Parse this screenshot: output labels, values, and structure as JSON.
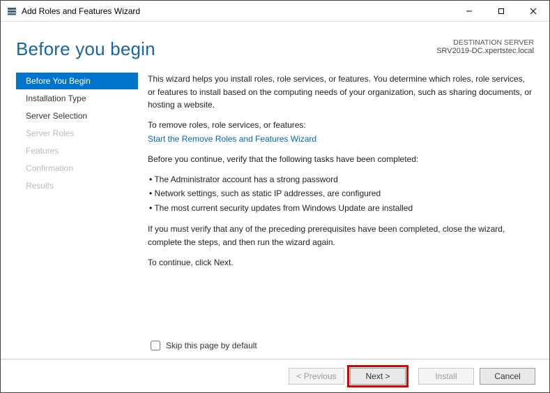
{
  "window": {
    "title": "Add Roles and Features Wizard",
    "icon": "server-manager-icon"
  },
  "header": {
    "title": "Before you begin",
    "destination_label": "DESTINATION SERVER",
    "destination_server": "SRV2019-DC.xpertstec.local"
  },
  "sidebar": {
    "items": [
      {
        "label": "Before You Begin",
        "state": "active"
      },
      {
        "label": "Installation Type",
        "state": "enabled"
      },
      {
        "label": "Server Selection",
        "state": "enabled"
      },
      {
        "label": "Server Roles",
        "state": "disabled"
      },
      {
        "label": "Features",
        "state": "disabled"
      },
      {
        "label": "Confirmation",
        "state": "disabled"
      },
      {
        "label": "Results",
        "state": "disabled"
      }
    ]
  },
  "content": {
    "intro": "This wizard helps you install roles, role services, or features. You determine which roles, role services, or features to install based on the computing needs of your organization, such as sharing documents, or hosting a website.",
    "remove_label": "To remove roles, role services, or features:",
    "remove_link": "Start the Remove Roles and Features Wizard",
    "verify_label": "Before you continue, verify that the following tasks have been completed:",
    "bullets": [
      "The Administrator account has a strong password",
      "Network settings, such as static IP addresses, are configured",
      "The most current security updates from Windows Update are installed"
    ],
    "post_bullets": "If you must verify that any of the preceding prerequisites have been completed, close the wizard, complete the steps, and then run the wizard again.",
    "continue_hint": "To continue, click Next."
  },
  "skip": {
    "label": "Skip this page by default",
    "checked": false
  },
  "footer": {
    "previous": "< Previous",
    "next": "Next >",
    "install": "Install",
    "cancel": "Cancel"
  }
}
